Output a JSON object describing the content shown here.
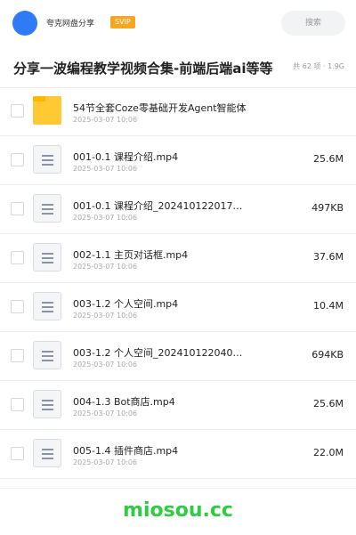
{
  "header": {
    "sharer": "夸克网盘分享",
    "badge": "SVIP",
    "search_placeholder": "搜索"
  },
  "title": "分享一波编程教学视频合集-前端后端ai等等",
  "summary": "共 62 项 · 1.9G",
  "items": [
    {
      "name": "54节全套Coze零基础开发Agent智能体",
      "date": "2025-03-07 10:06",
      "size": "",
      "type": "folder"
    },
    {
      "name": "001-0.1 课程介绍.mp4",
      "date": "2025-03-07 10:06",
      "size": "25.6M",
      "type": "file"
    },
    {
      "name": "001-0.1 课程介绍_202410122017…",
      "date": "2025-03-07 10:06",
      "size": "497KB",
      "type": "file"
    },
    {
      "name": "002-1.1 主页对话框.mp4",
      "date": "2025-03-07 10:06",
      "size": "37.6M",
      "type": "file"
    },
    {
      "name": "003-1.2 个人空间.mp4",
      "date": "2025-03-07 10:06",
      "size": "10.4M",
      "type": "file"
    },
    {
      "name": "003-1.2 个人空间_202410122040…",
      "date": "2025-03-07 10:06",
      "size": "694KB",
      "type": "file"
    },
    {
      "name": "004-1.3 Bot商店.mp4",
      "date": "2025-03-07 10:06",
      "size": "25.6M",
      "type": "file"
    },
    {
      "name": "005-1.4 插件商店.mp4",
      "date": "2025-03-07 10:06",
      "size": "22.0M",
      "type": "file"
    }
  ],
  "footer": {
    "brand": "miosou.cc"
  },
  "colors": {
    "accent": "#2f7bf5",
    "svip": "#f5a623",
    "folder": "#ffc933",
    "brand": "#2ecc40"
  },
  "icons": {
    "folder": "folder-icon",
    "file": "file-icon",
    "avatar": "avatar"
  }
}
